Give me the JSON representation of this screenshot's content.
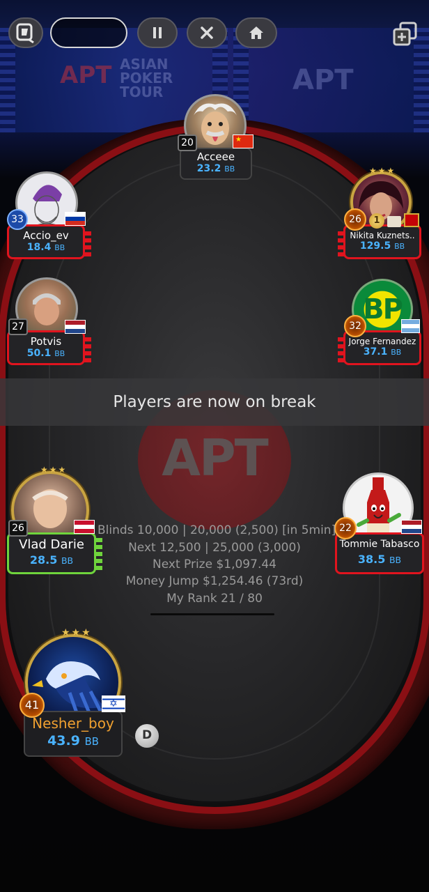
{
  "header": {
    "logo_icon": "apt-logo-icon",
    "pause_icon": "pause-icon",
    "close_icon": "close-icon",
    "home_icon": "home-icon",
    "add_table_icon": "add-table-icon"
  },
  "background": {
    "banner_logo": "APT",
    "banner_text_1": "ASIAN",
    "banner_text_2": "POKER",
    "banner_text_3": "TOUR",
    "banner_logo_right": "APT",
    "table_logo": "APT"
  },
  "players": {
    "acceee": {
      "name": "Acceee",
      "stack": "23.2",
      "unit": "BB",
      "level": "20",
      "flag": "china"
    },
    "accio": {
      "name": "Accio_ev",
      "stack": "18.4",
      "unit": "BB",
      "level": "33",
      "flag": "russia"
    },
    "nikita": {
      "name": "Nikita Kuznets..",
      "stack": "129.5",
      "unit": "BB",
      "level": "26",
      "flag": "montenegro",
      "badge": "1"
    },
    "potvis": {
      "name": "Potvis",
      "stack": "50.1",
      "unit": "BB",
      "level": "27",
      "flag": "netherlands"
    },
    "jorge": {
      "name": "Jorge Fernandez",
      "stack": "37.1",
      "unit": "BB",
      "level": "32",
      "flag": "argentina",
      "avatar_text": "BP"
    },
    "vlad": {
      "name": "Vlad Darie",
      "stack": "28.5",
      "unit": "BB",
      "level": "26",
      "flag": "austria"
    },
    "tommie": {
      "name": "Tommie Tabasco",
      "stack": "38.5",
      "unit": "BB",
      "level": "22",
      "flag": "netherlands"
    },
    "nesher": {
      "name": "Nesher_boy",
      "stack": "43.9",
      "unit": "BB",
      "level": "41",
      "flag": "israel"
    }
  },
  "table": {
    "break_message": "Players are now on break",
    "blinds": "Blinds 10,000 | 20,000 (2,500) [in 5min]",
    "next": "Next 12,500 | 25,000 (3,000)",
    "next_prize": "Next Prize $1,097.44",
    "money_jump": "Money Jump $1,254.46 (73rd)",
    "my_rank": "My Rank 21 / 80",
    "dealer_button": "D"
  },
  "colors": {
    "stack_blue": "#4ab3ff",
    "plate_red": "#e0141e",
    "plate_green": "#6fd43c",
    "hero_name": "#f0a030"
  }
}
